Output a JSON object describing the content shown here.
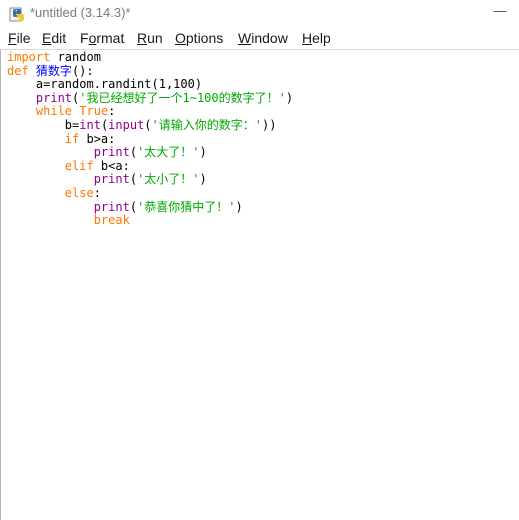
{
  "window": {
    "title": "*untitled (3.14.3)*",
    "minimize_glyph": "—",
    "icon": "python-idle-icon"
  },
  "menubar": {
    "items": [
      {
        "mnemonic": "F",
        "rest": "ile"
      },
      {
        "mnemonic": "E",
        "rest": "dit"
      },
      {
        "pre": "F",
        "mnemonic": "o",
        "rest": "rmat"
      },
      {
        "mnemonic": "R",
        "rest": "un"
      },
      {
        "mnemonic": "O",
        "rest": "ptions"
      },
      {
        "mnemonic": "W",
        "rest": "indow"
      },
      {
        "mnemonic": "H",
        "rest": "elp"
      }
    ]
  },
  "editor": {
    "lines": [
      [
        {
          "t": "kw",
          "v": "import"
        },
        {
          "t": "plain",
          "v": " random"
        }
      ],
      [
        {
          "t": "kw",
          "v": "def"
        },
        {
          "t": "plain",
          "v": " "
        },
        {
          "t": "def",
          "v": "猜数字"
        },
        {
          "t": "plain",
          "v": "():"
        }
      ],
      [
        {
          "t": "plain",
          "v": "    a=random.randint(1,100)"
        }
      ],
      [
        {
          "t": "plain",
          "v": "    "
        },
        {
          "t": "bi",
          "v": "print"
        },
        {
          "t": "plain",
          "v": "("
        },
        {
          "t": "str",
          "v": "'我已经想好了一个1~100的数字了！'"
        },
        {
          "t": "plain",
          "v": ")"
        }
      ],
      [
        {
          "t": "plain",
          "v": "    "
        },
        {
          "t": "kw",
          "v": "while"
        },
        {
          "t": "plain",
          "v": " "
        },
        {
          "t": "kw",
          "v": "True"
        },
        {
          "t": "plain",
          "v": ":"
        }
      ],
      [
        {
          "t": "plain",
          "v": "        b="
        },
        {
          "t": "bi",
          "v": "int"
        },
        {
          "t": "plain",
          "v": "("
        },
        {
          "t": "bi",
          "v": "input"
        },
        {
          "t": "plain",
          "v": "("
        },
        {
          "t": "str",
          "v": "'请输入你的数字：'"
        },
        {
          "t": "plain",
          "v": "))"
        }
      ],
      [
        {
          "t": "plain",
          "v": "        "
        },
        {
          "t": "kw",
          "v": "if"
        },
        {
          "t": "plain",
          "v": " b>a:"
        }
      ],
      [
        {
          "t": "plain",
          "v": "            "
        },
        {
          "t": "bi",
          "v": "print"
        },
        {
          "t": "plain",
          "v": "("
        },
        {
          "t": "str",
          "v": "'太大了！'"
        },
        {
          "t": "plain",
          "v": ")"
        }
      ],
      [
        {
          "t": "plain",
          "v": "        "
        },
        {
          "t": "kw",
          "v": "elif"
        },
        {
          "t": "plain",
          "v": " b<a:"
        }
      ],
      [
        {
          "t": "plain",
          "v": "            "
        },
        {
          "t": "bi",
          "v": "print"
        },
        {
          "t": "plain",
          "v": "("
        },
        {
          "t": "str",
          "v": "'太小了！'"
        },
        {
          "t": "plain",
          "v": ")"
        }
      ],
      [
        {
          "t": "plain",
          "v": "        "
        },
        {
          "t": "kw",
          "v": "else"
        },
        {
          "t": "plain",
          "v": ":"
        }
      ],
      [
        {
          "t": "plain",
          "v": "            "
        },
        {
          "t": "bi",
          "v": "print"
        },
        {
          "t": "plain",
          "v": "("
        },
        {
          "t": "str",
          "v": "'恭喜你猜中了！'"
        },
        {
          "t": "plain",
          "v": ")"
        }
      ],
      [
        {
          "t": "plain",
          "v": "            "
        },
        {
          "t": "kw",
          "v": "break"
        }
      ]
    ]
  },
  "colors": {
    "keyword": "#ff7700",
    "definition": "#0000ff",
    "builtin": "#900090",
    "string": "#00aa00",
    "text": "#000000"
  }
}
